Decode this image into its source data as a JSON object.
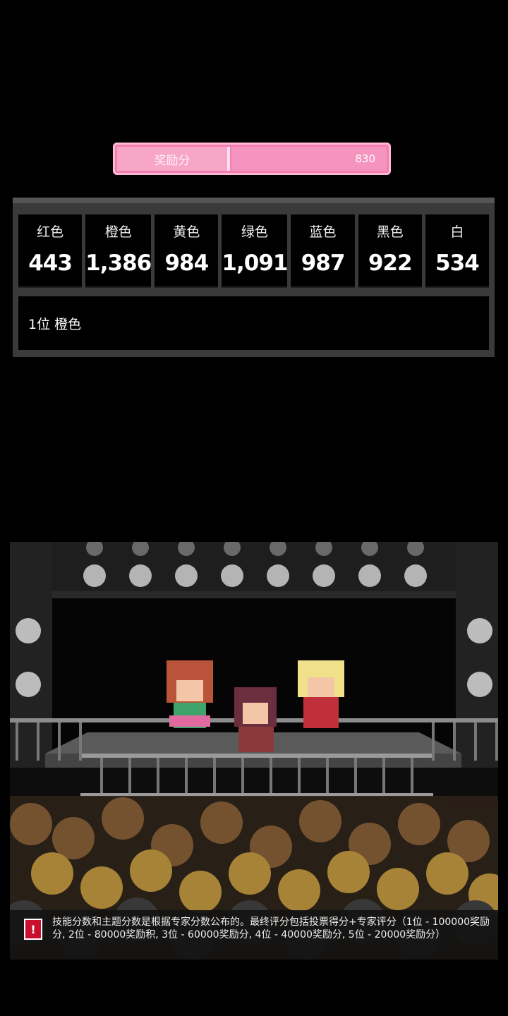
{
  "reward": {
    "label": "奖励分",
    "value": "830"
  },
  "votes": [
    {
      "name": "红色",
      "count": "443"
    },
    {
      "name": "橙色",
      "count": "1,386"
    },
    {
      "name": "黄色",
      "count": "984"
    },
    {
      "name": "绿色",
      "count": "1,091"
    },
    {
      "name": "蓝色",
      "count": "987"
    },
    {
      "name": "黑色",
      "count": "922"
    },
    {
      "name": "白",
      "count": "534"
    }
  ],
  "ranking": {
    "text": "1位 橙色"
  },
  "notice": {
    "icon": "info-icon",
    "text": "技能分数和主题分数是根据专家分数公布的。最终评分包括投票得分+专家评分（1位 - 100000奖励分, 2位 - 80000奖励积, 3位 - 60000奖励分, 4位 - 40000奖励分, 5位 - 20000奖励分）"
  },
  "colors": {
    "reward_pink": "#f27fb0",
    "panel_gray": "#3a3a3a",
    "notice_red": "#c8102e"
  }
}
